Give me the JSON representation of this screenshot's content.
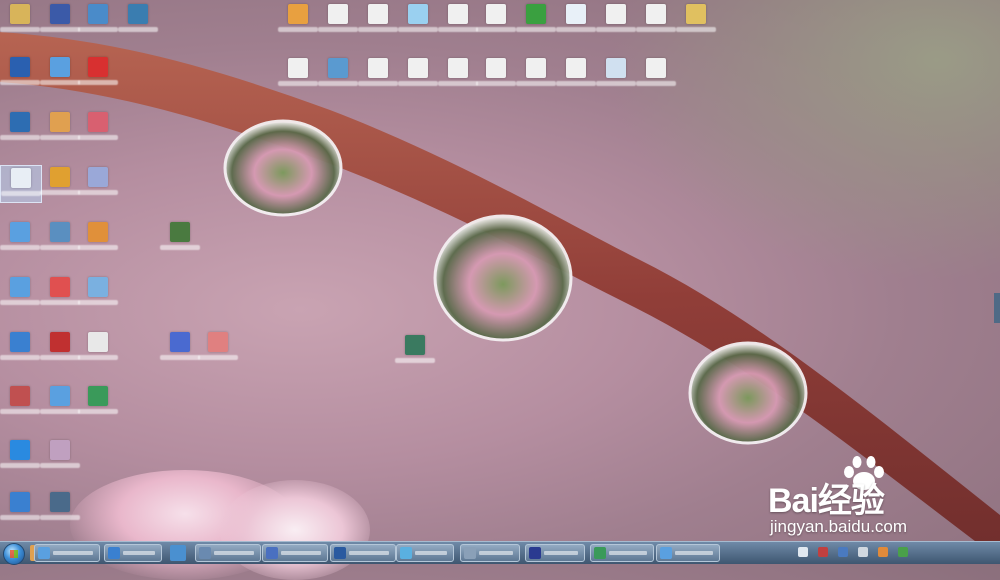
{
  "watermark": {
    "brand": "Bai经验",
    "url": "jingyan.baidu.com"
  },
  "desktop": {
    "icons": [
      {
        "color": "#d8b45a"
      },
      {
        "color": "#3b5aa8"
      },
      {
        "color": "#4a8bc9"
      },
      {
        "color": "#3a7db0"
      },
      {
        "color": "#2a60b0"
      },
      {
        "color": "#5aa0e0"
      },
      {
        "color": "#d83030"
      },
      {
        "color": "#2d6db2"
      },
      {
        "color": "#e0a050"
      },
      {
        "color": "#d86070"
      },
      {
        "color": "#e8eef5"
      },
      {
        "color": "#e0a030"
      },
      {
        "color": "#9aa8d8"
      },
      {
        "color": "#5aa0e0"
      },
      {
        "color": "#5a8fc0"
      },
      {
        "color": "#e0903a"
      },
      {
        "color": "#4a7a40"
      },
      {
        "color": "#5aa0e0"
      },
      {
        "color": "#e05050"
      },
      {
        "color": "#7ab0e0"
      },
      {
        "color": "#3a80d0"
      },
      {
        "color": "#c03030"
      },
      {
        "color": "#e8e8e8"
      },
      {
        "color": "#4a6ad0"
      },
      {
        "color": "#e08080"
      },
      {
        "color": "#3a7a60"
      },
      {
        "color": "#c05050"
      },
      {
        "color": "#5aa0e0"
      },
      {
        "color": "#3a9a5a"
      },
      {
        "color": "#2a8ae0"
      },
      {
        "color": "#c0a0c0"
      },
      {
        "color": "#3a80d0"
      },
      {
        "color": "#4a6a8a"
      },
      {
        "color": "#e8a040"
      },
      {
        "color": "#f0f0f0"
      },
      {
        "color": "#f0f0f0"
      },
      {
        "color": "#9ad0f0"
      },
      {
        "color": "#f0f0f0"
      },
      {
        "color": "#f0f0f0"
      },
      {
        "color": "#3aa040"
      },
      {
        "color": "#e8f0f8"
      },
      {
        "color": "#f0f0f0"
      },
      {
        "color": "#f0f0f0"
      },
      {
        "color": "#e0c060"
      },
      {
        "color": "#f0f0f0"
      },
      {
        "color": "#5a9ad0"
      },
      {
        "color": "#f0f0f0"
      },
      {
        "color": "#f0f0f0"
      },
      {
        "color": "#f0f0f0"
      },
      {
        "color": "#f0f0f0"
      },
      {
        "color": "#f0f0f0"
      },
      {
        "color": "#f0f0f0"
      },
      {
        "color": "#d0e0f0"
      },
      {
        "color": "#f0f0f0"
      }
    ]
  },
  "taskbar": {
    "quick_colors": [
      "#e0a050",
      "#4a90d0"
    ],
    "tasks": [
      {
        "color": "#5aa0e0"
      },
      {
        "color": "#3a80d0"
      },
      {
        "color": "#6a8ab0"
      },
      {
        "color": "#4a70c0"
      },
      {
        "color": "#2a5aa0"
      },
      {
        "color": "#5ab0e0"
      },
      {
        "color": "#8aa0b8"
      },
      {
        "color": "#2a3a90"
      },
      {
        "color": "#3a9a5a"
      },
      {
        "color": "#5aa0e0"
      }
    ],
    "tray_colors": [
      "#e0e8f0",
      "#c04040",
      "#4a7ac0",
      "#d0d8e0",
      "#e08a3a",
      "#4aa04a"
    ]
  }
}
